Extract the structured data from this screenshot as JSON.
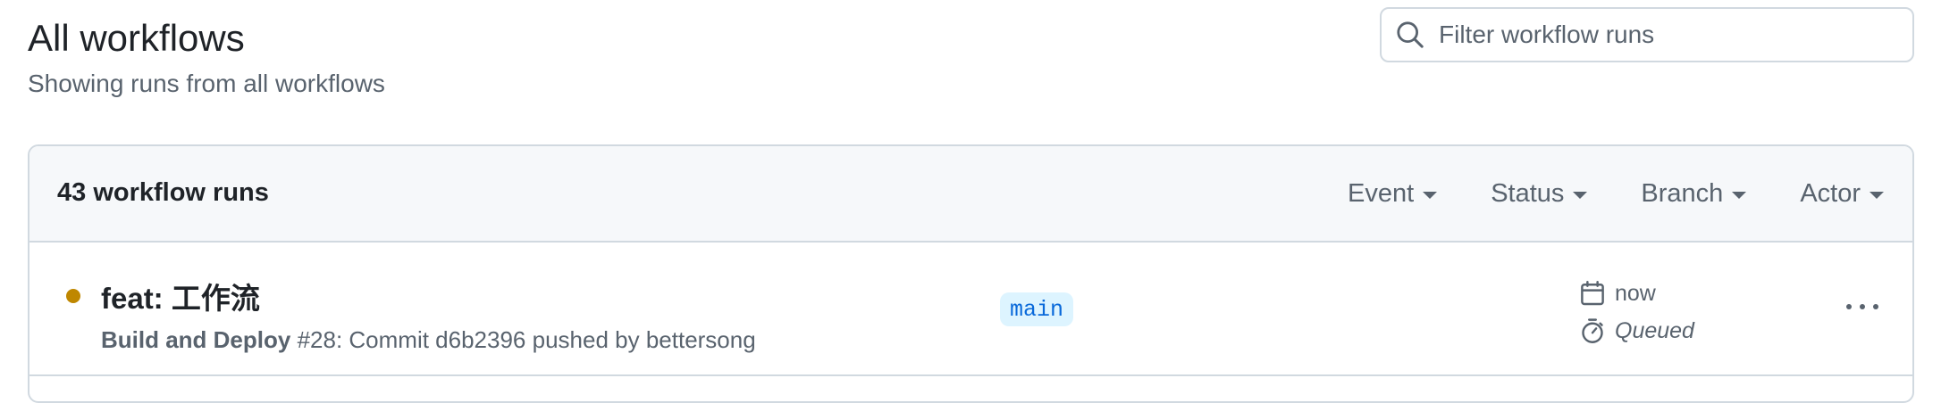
{
  "header": {
    "title": "All workflows",
    "subtitle": "Showing runs from all workflows"
  },
  "search": {
    "placeholder": "Filter workflow runs",
    "icon": "search-icon"
  },
  "runs_box": {
    "count_label": "43 workflow runs",
    "filters": [
      {
        "label": "Event"
      },
      {
        "label": "Status"
      },
      {
        "label": "Branch"
      },
      {
        "label": "Actor"
      }
    ],
    "runs": [
      {
        "title": "feat: 工作流",
        "workflow_name": "Build and Deploy",
        "run_description": " #28: Commit d6b2396 pushed by bettersong",
        "branch": "main",
        "time": "now",
        "status": "Queued",
        "status_color": "#bf8700"
      }
    ]
  },
  "colors": {
    "accent_blue": "#0969da",
    "branch_bg": "#ddf4ff",
    "queued_yellow": "#bf8700",
    "border": "#d1d9e0",
    "header_bg": "#f6f8fa",
    "muted_text": "#59636e"
  }
}
